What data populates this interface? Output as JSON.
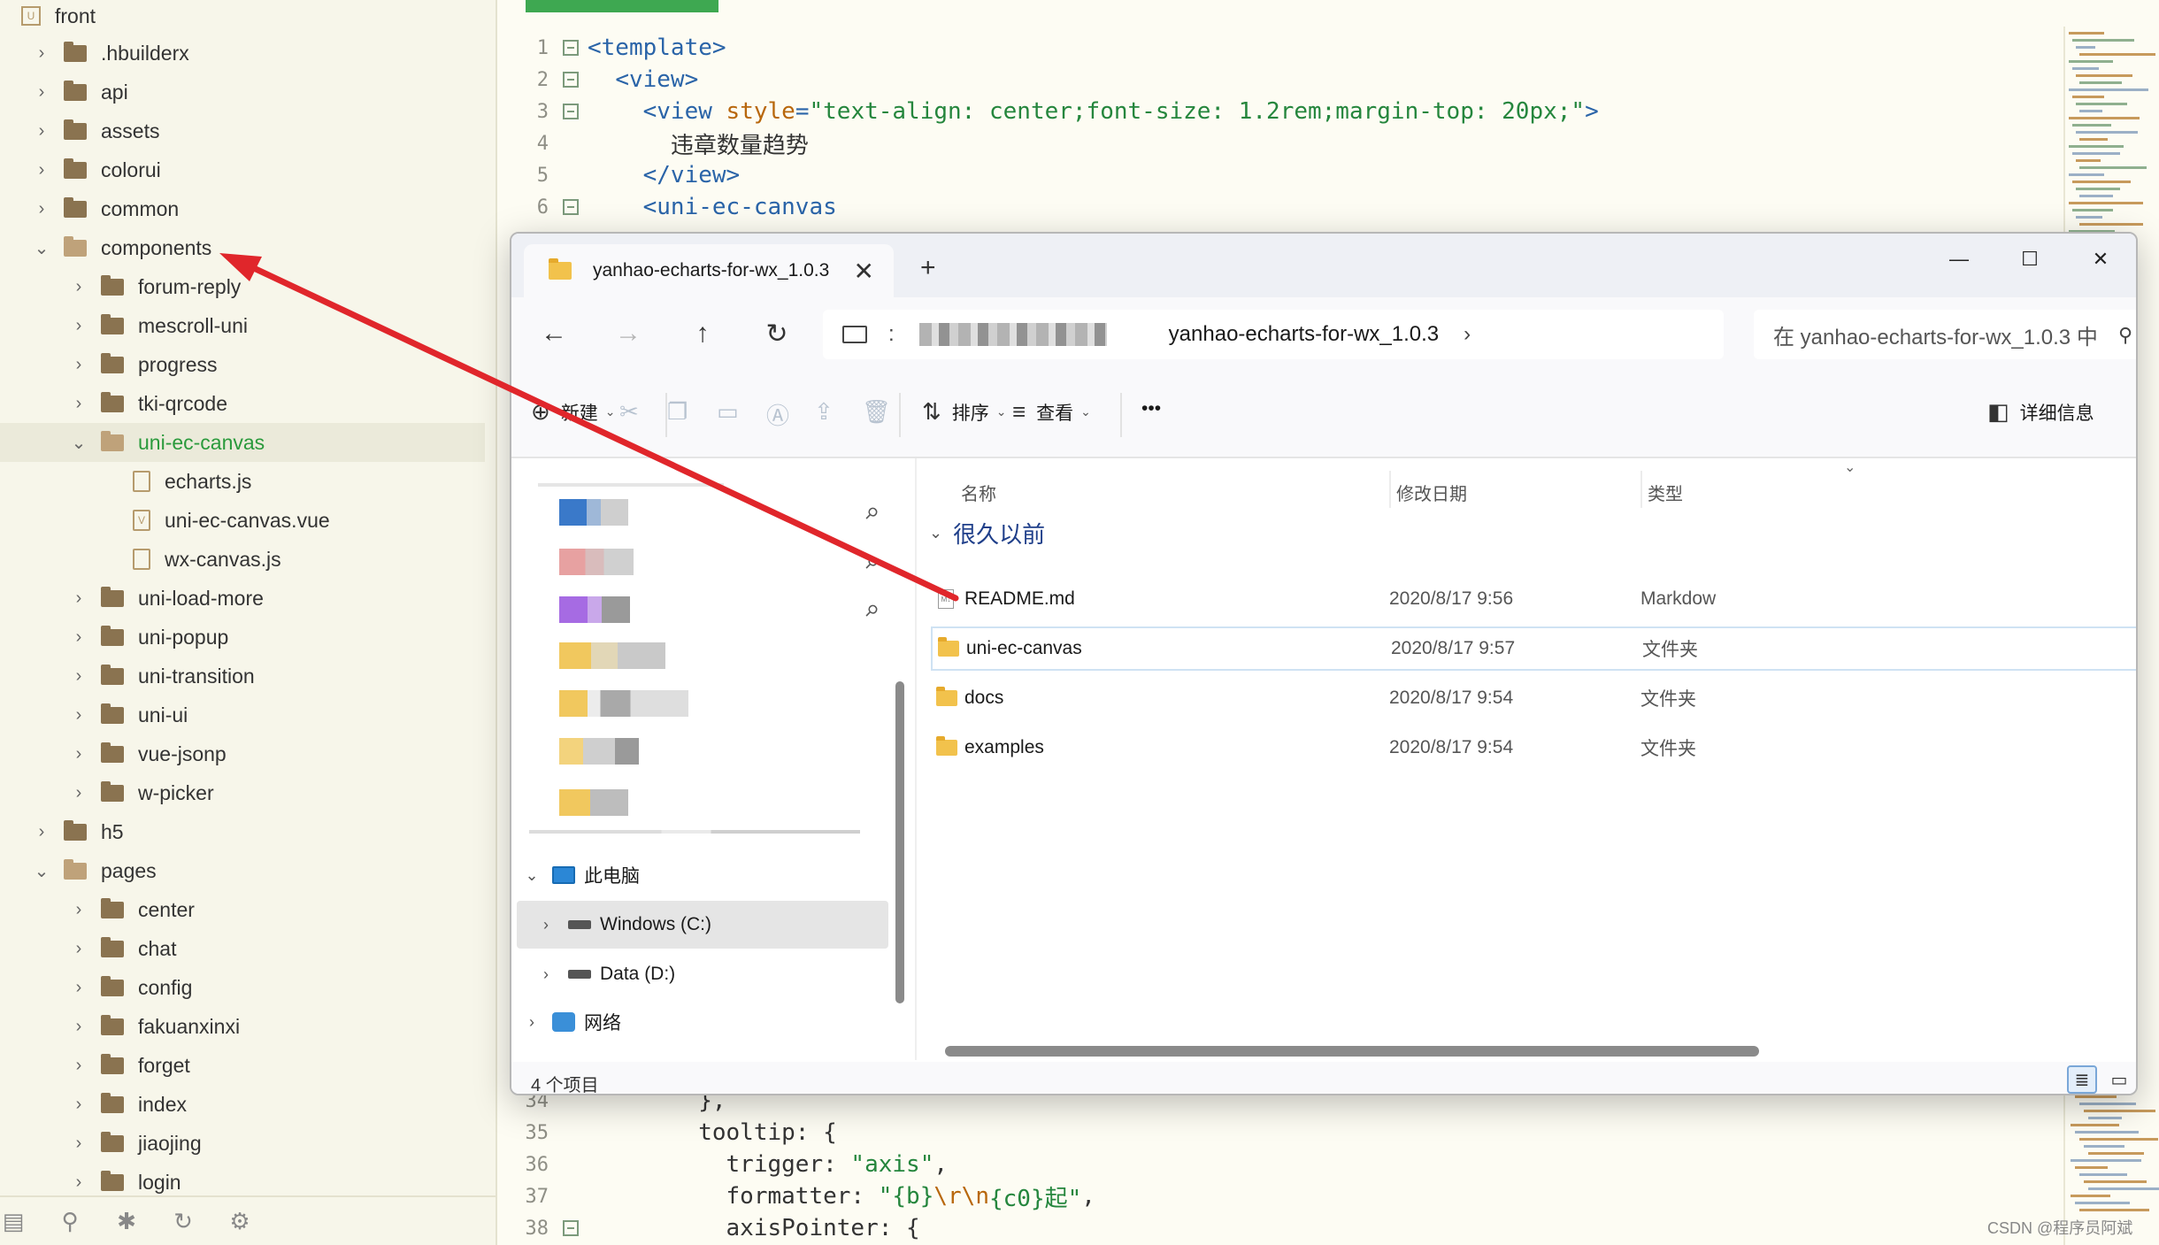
{
  "tree": {
    "root": "front",
    "items": [
      {
        "label": ".hbuilderx",
        "level": 1,
        "kind": "folder",
        "expanded": false
      },
      {
        "label": "api",
        "level": 1,
        "kind": "folder",
        "expanded": false
      },
      {
        "label": "assets",
        "level": 1,
        "kind": "folder",
        "expanded": false
      },
      {
        "label": "colorui",
        "level": 1,
        "kind": "folder",
        "expanded": false
      },
      {
        "label": "common",
        "level": 1,
        "kind": "folder",
        "expanded": false
      },
      {
        "label": "components",
        "level": 1,
        "kind": "folder",
        "expanded": true
      },
      {
        "label": "forum-reply",
        "level": 2,
        "kind": "folder",
        "expanded": false
      },
      {
        "label": "mescroll-uni",
        "level": 2,
        "kind": "folder",
        "expanded": false
      },
      {
        "label": "progress",
        "level": 2,
        "kind": "folder",
        "expanded": false
      },
      {
        "label": "tki-qrcode",
        "level": 2,
        "kind": "folder",
        "expanded": false
      },
      {
        "label": "uni-ec-canvas",
        "level": 2,
        "kind": "folder",
        "expanded": true,
        "active": true
      },
      {
        "label": "echarts.js",
        "level": 3,
        "kind": "file",
        "icon": "js"
      },
      {
        "label": "uni-ec-canvas.vue",
        "level": 3,
        "kind": "file",
        "icon": "V"
      },
      {
        "label": "wx-canvas.js",
        "level": 3,
        "kind": "file",
        "icon": "js"
      },
      {
        "label": "uni-load-more",
        "level": 2,
        "kind": "folder",
        "expanded": false
      },
      {
        "label": "uni-popup",
        "level": 2,
        "kind": "folder",
        "expanded": false
      },
      {
        "label": "uni-transition",
        "level": 2,
        "kind": "folder",
        "expanded": false
      },
      {
        "label": "uni-ui",
        "level": 2,
        "kind": "folder",
        "expanded": false
      },
      {
        "label": "vue-jsonp",
        "level": 2,
        "kind": "folder",
        "expanded": false
      },
      {
        "label": "w-picker",
        "level": 2,
        "kind": "folder",
        "expanded": false
      },
      {
        "label": "h5",
        "level": 1,
        "kind": "folder",
        "expanded": false
      },
      {
        "label": "pages",
        "level": 1,
        "kind": "folder",
        "expanded": true
      },
      {
        "label": "center",
        "level": 2,
        "kind": "folder",
        "expanded": false
      },
      {
        "label": "chat",
        "level": 2,
        "kind": "folder",
        "expanded": false
      },
      {
        "label": "config",
        "level": 2,
        "kind": "folder",
        "expanded": false
      },
      {
        "label": "fakuanxinxi",
        "level": 2,
        "kind": "folder",
        "expanded": false
      },
      {
        "label": "forget",
        "level": 2,
        "kind": "folder",
        "expanded": false
      },
      {
        "label": "index",
        "level": 2,
        "kind": "folder",
        "expanded": false
      },
      {
        "label": "jiaojing",
        "level": 2,
        "kind": "folder",
        "expanded": false
      },
      {
        "label": "login",
        "level": 2,
        "kind": "folder",
        "expanded": false
      }
    ],
    "toolbar_icons": [
      "panel-icon",
      "bicycle-icon",
      "bug-icon",
      "refresh-icon",
      "plugin-icon"
    ]
  },
  "editor": {
    "top_lines": [
      {
        "num": "1",
        "fold": true,
        "parts": [
          [
            "tag",
            "<template>"
          ]
        ]
      },
      {
        "num": "2",
        "fold": true,
        "parts": [
          [
            "code",
            "  "
          ],
          [
            "tag",
            "<view>"
          ]
        ]
      },
      {
        "num": "3",
        "fold": true,
        "parts": [
          [
            "code",
            "    "
          ],
          [
            "tag",
            "<view "
          ],
          [
            "attr",
            "style"
          ],
          [
            "tag",
            "="
          ],
          [
            "str",
            "\"text-align: center;font-size: 1.2rem;margin-top: 20px;\""
          ],
          [
            "tag",
            ">"
          ]
        ]
      },
      {
        "num": "4",
        "fold": false,
        "parts": [
          [
            "code",
            "      "
          ],
          [
            "cjk",
            "违章数量趋势"
          ]
        ]
      },
      {
        "num": "5",
        "fold": false,
        "parts": [
          [
            "code",
            "    "
          ],
          [
            "tag",
            "</view>"
          ]
        ]
      },
      {
        "num": "6",
        "fold": true,
        "parts": [
          [
            "code",
            "    "
          ],
          [
            "tag",
            "<uni-ec-canvas"
          ]
        ]
      }
    ],
    "bottom_lines": [
      {
        "num": "34",
        "fold": false,
        "parts": [
          [
            "code",
            "        },"
          ]
        ]
      },
      {
        "num": "35",
        "fold": false,
        "parts": [
          [
            "code",
            "        tooltip: {"
          ]
        ]
      },
      {
        "num": "36",
        "fold": false,
        "parts": [
          [
            "code",
            "          trigger: "
          ],
          [
            "str",
            "\"axis\""
          ],
          [
            "code",
            ","
          ]
        ]
      },
      {
        "num": "37",
        "fold": false,
        "parts": [
          [
            "code",
            "          formatter: "
          ],
          [
            "str",
            "\"{b}"
          ],
          [
            "attr",
            "\\r\\n"
          ],
          [
            "str",
            "{c0}起\""
          ],
          [
            "code",
            ","
          ]
        ]
      },
      {
        "num": "38",
        "fold": true,
        "parts": [
          [
            "code",
            "          axisPointer: {"
          ]
        ]
      }
    ]
  },
  "explorer": {
    "tab_title": "yanhao-echarts-for-wx_1.0.3",
    "tab_close": "✕",
    "new_tab": "+",
    "window_buttons": {
      "minimize": "—",
      "maximize": "☐",
      "close": "✕"
    },
    "nav": {
      "back": "←",
      "forward": "→",
      "up": "↑",
      "refresh": "↻"
    },
    "address": {
      "separator": ":",
      "current": "yanhao-echarts-for-wx_1.0.3",
      "chevron": "›"
    },
    "search_placeholder": "在 yanhao-echarts-for-wx_1.0.3 中",
    "commands": {
      "new": "新建",
      "sort": "排序",
      "view": "查看",
      "more": "•••",
      "details": "详细信息"
    },
    "nav_pane": {
      "this_pc": "此电脑",
      "drive_c": "Windows (C:)",
      "drive_d": "Data (D:)",
      "network": "网络"
    },
    "columns": {
      "name": "名称",
      "modified": "修改日期",
      "type": "类型"
    },
    "group_label": "很久以前",
    "files": [
      {
        "name": "README.md",
        "modified": "2020/8/17 9:56",
        "type": "Markdow",
        "icon": "md"
      },
      {
        "name": "uni-ec-canvas",
        "modified": "2020/8/17 9:57",
        "type": "文件夹",
        "icon": "folder",
        "selected": true
      },
      {
        "name": "docs",
        "modified": "2020/8/17 9:54",
        "type": "文件夹",
        "icon": "folder"
      },
      {
        "name": "examples",
        "modified": "2020/8/17 9:54",
        "type": "文件夹",
        "icon": "folder"
      }
    ],
    "status_text": "4 个项目"
  },
  "annotation": {
    "color": "#e0262b"
  },
  "watermark": "CSDN @程序员阿斌"
}
